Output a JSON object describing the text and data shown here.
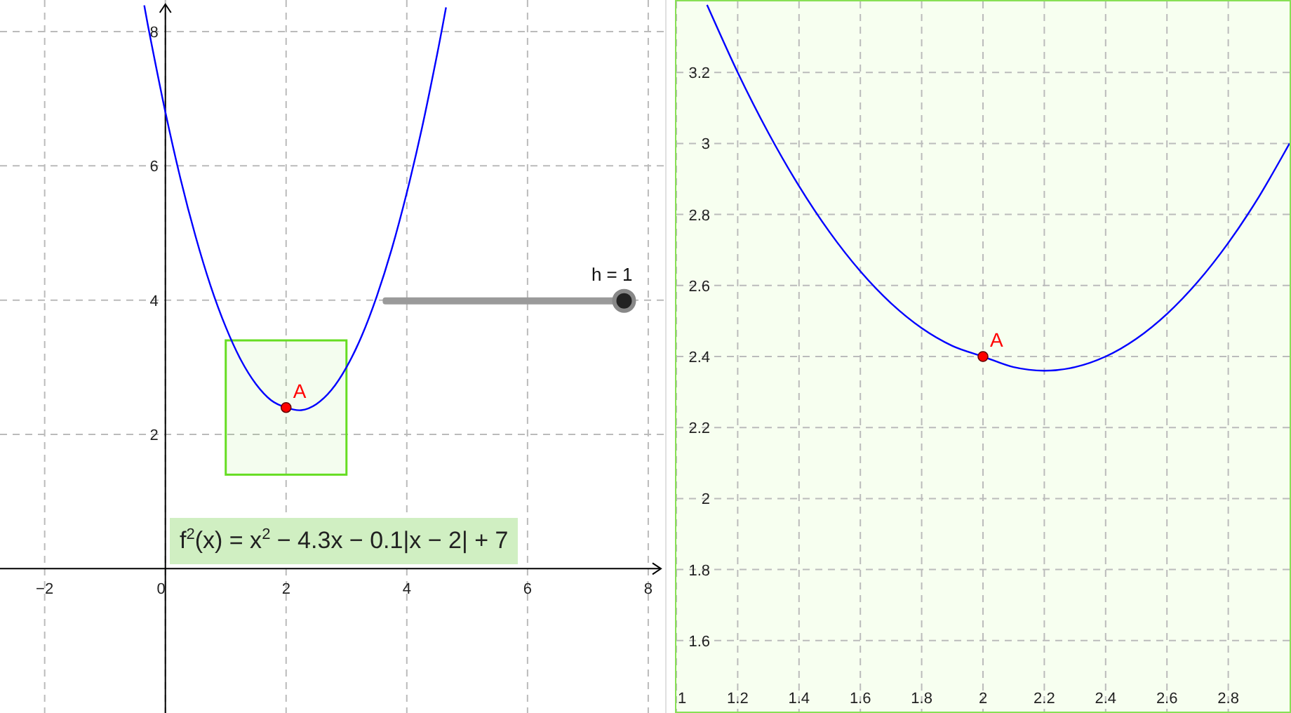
{
  "views": [
    {
      "kind": "main",
      "chart_data": {
        "type": "line",
        "grid": true,
        "xlim": [
          -2.74,
          8.28
        ],
        "ylim": [
          -2.15,
          8.47
        ],
        "xticks": [
          {
            "value": -2,
            "label": "−2"
          },
          {
            "value": 0,
            "label": "0"
          },
          {
            "value": 2,
            "label": "2"
          },
          {
            "value": 4,
            "label": "4"
          },
          {
            "value": 6,
            "label": "6"
          },
          {
            "value": 8,
            "label": "8"
          }
        ],
        "yticks": [
          2,
          4,
          6,
          8
        ],
        "x": [
          -0.35,
          -0.25,
          0,
          0.25,
          0.5,
          0.75,
          1,
          1.25,
          1.5,
          1.75,
          2,
          2.25,
          2.5,
          2.75,
          3,
          3.25,
          3.5,
          3.75,
          4,
          4.25,
          4.5,
          4.65
        ],
        "series": [
          {
            "color": "#0000ff",
            "values": [
              8.39,
              7.91,
              6.8,
              5.81,
              4.95,
              4.21,
              3.6,
              3.11,
              2.75,
              2.51,
              2.4,
              2.36,
              2.45,
              2.66,
              3,
              3.46,
              4.05,
              4.76,
              5.6,
              6.56,
              7.65,
              8.36
            ]
          }
        ],
        "annotations": [
          {
            "x": 2,
            "y": 2.4,
            "text": "A"
          }
        ]
      },
      "slider": {
        "label": "h = 1",
        "level": 1
      },
      "formula": "f$^{2}$(x) = x$^{2}$ − 4.3x − 0.1|x − 2| + 7"
    },
    {
      "kind": "zoom",
      "chart_data": {
        "type": "line",
        "grid": true,
        "xlim": [
          1,
          3
        ],
        "ylim": [
          1.4,
          3.4
        ],
        "xticks": [
          1,
          1.2,
          1.4,
          1.6,
          1.8,
          2,
          2.2,
          2.4,
          2.6,
          2.8
        ],
        "yticks": [
          1.6,
          1.8,
          2,
          2.2,
          2.4,
          2.6,
          2.8,
          3,
          3.2
        ],
        "x": [
          1.1,
          1.2,
          1.3,
          1.4,
          1.5,
          1.6,
          1.7,
          1.8,
          1.9,
          2,
          2.1,
          2.2,
          2.3,
          2.4,
          2.5,
          2.6,
          2.7,
          2.8,
          2.9,
          3
        ],
        "series": [
          {
            "color": "#0000ff",
            "values": [
              3.39,
              3.2,
              3.03,
              2.88,
              2.75,
              2.64,
              2.55,
              2.48,
              2.43,
              2.4,
              2.37,
              2.36,
              2.37,
              2.4,
              2.45,
              2.52,
              2.61,
              2.72,
              2.85,
              3
            ]
          }
        ],
        "annotations": [
          {
            "x": 2,
            "y": 2.4,
            "text": "A"
          }
        ]
      }
    }
  ]
}
